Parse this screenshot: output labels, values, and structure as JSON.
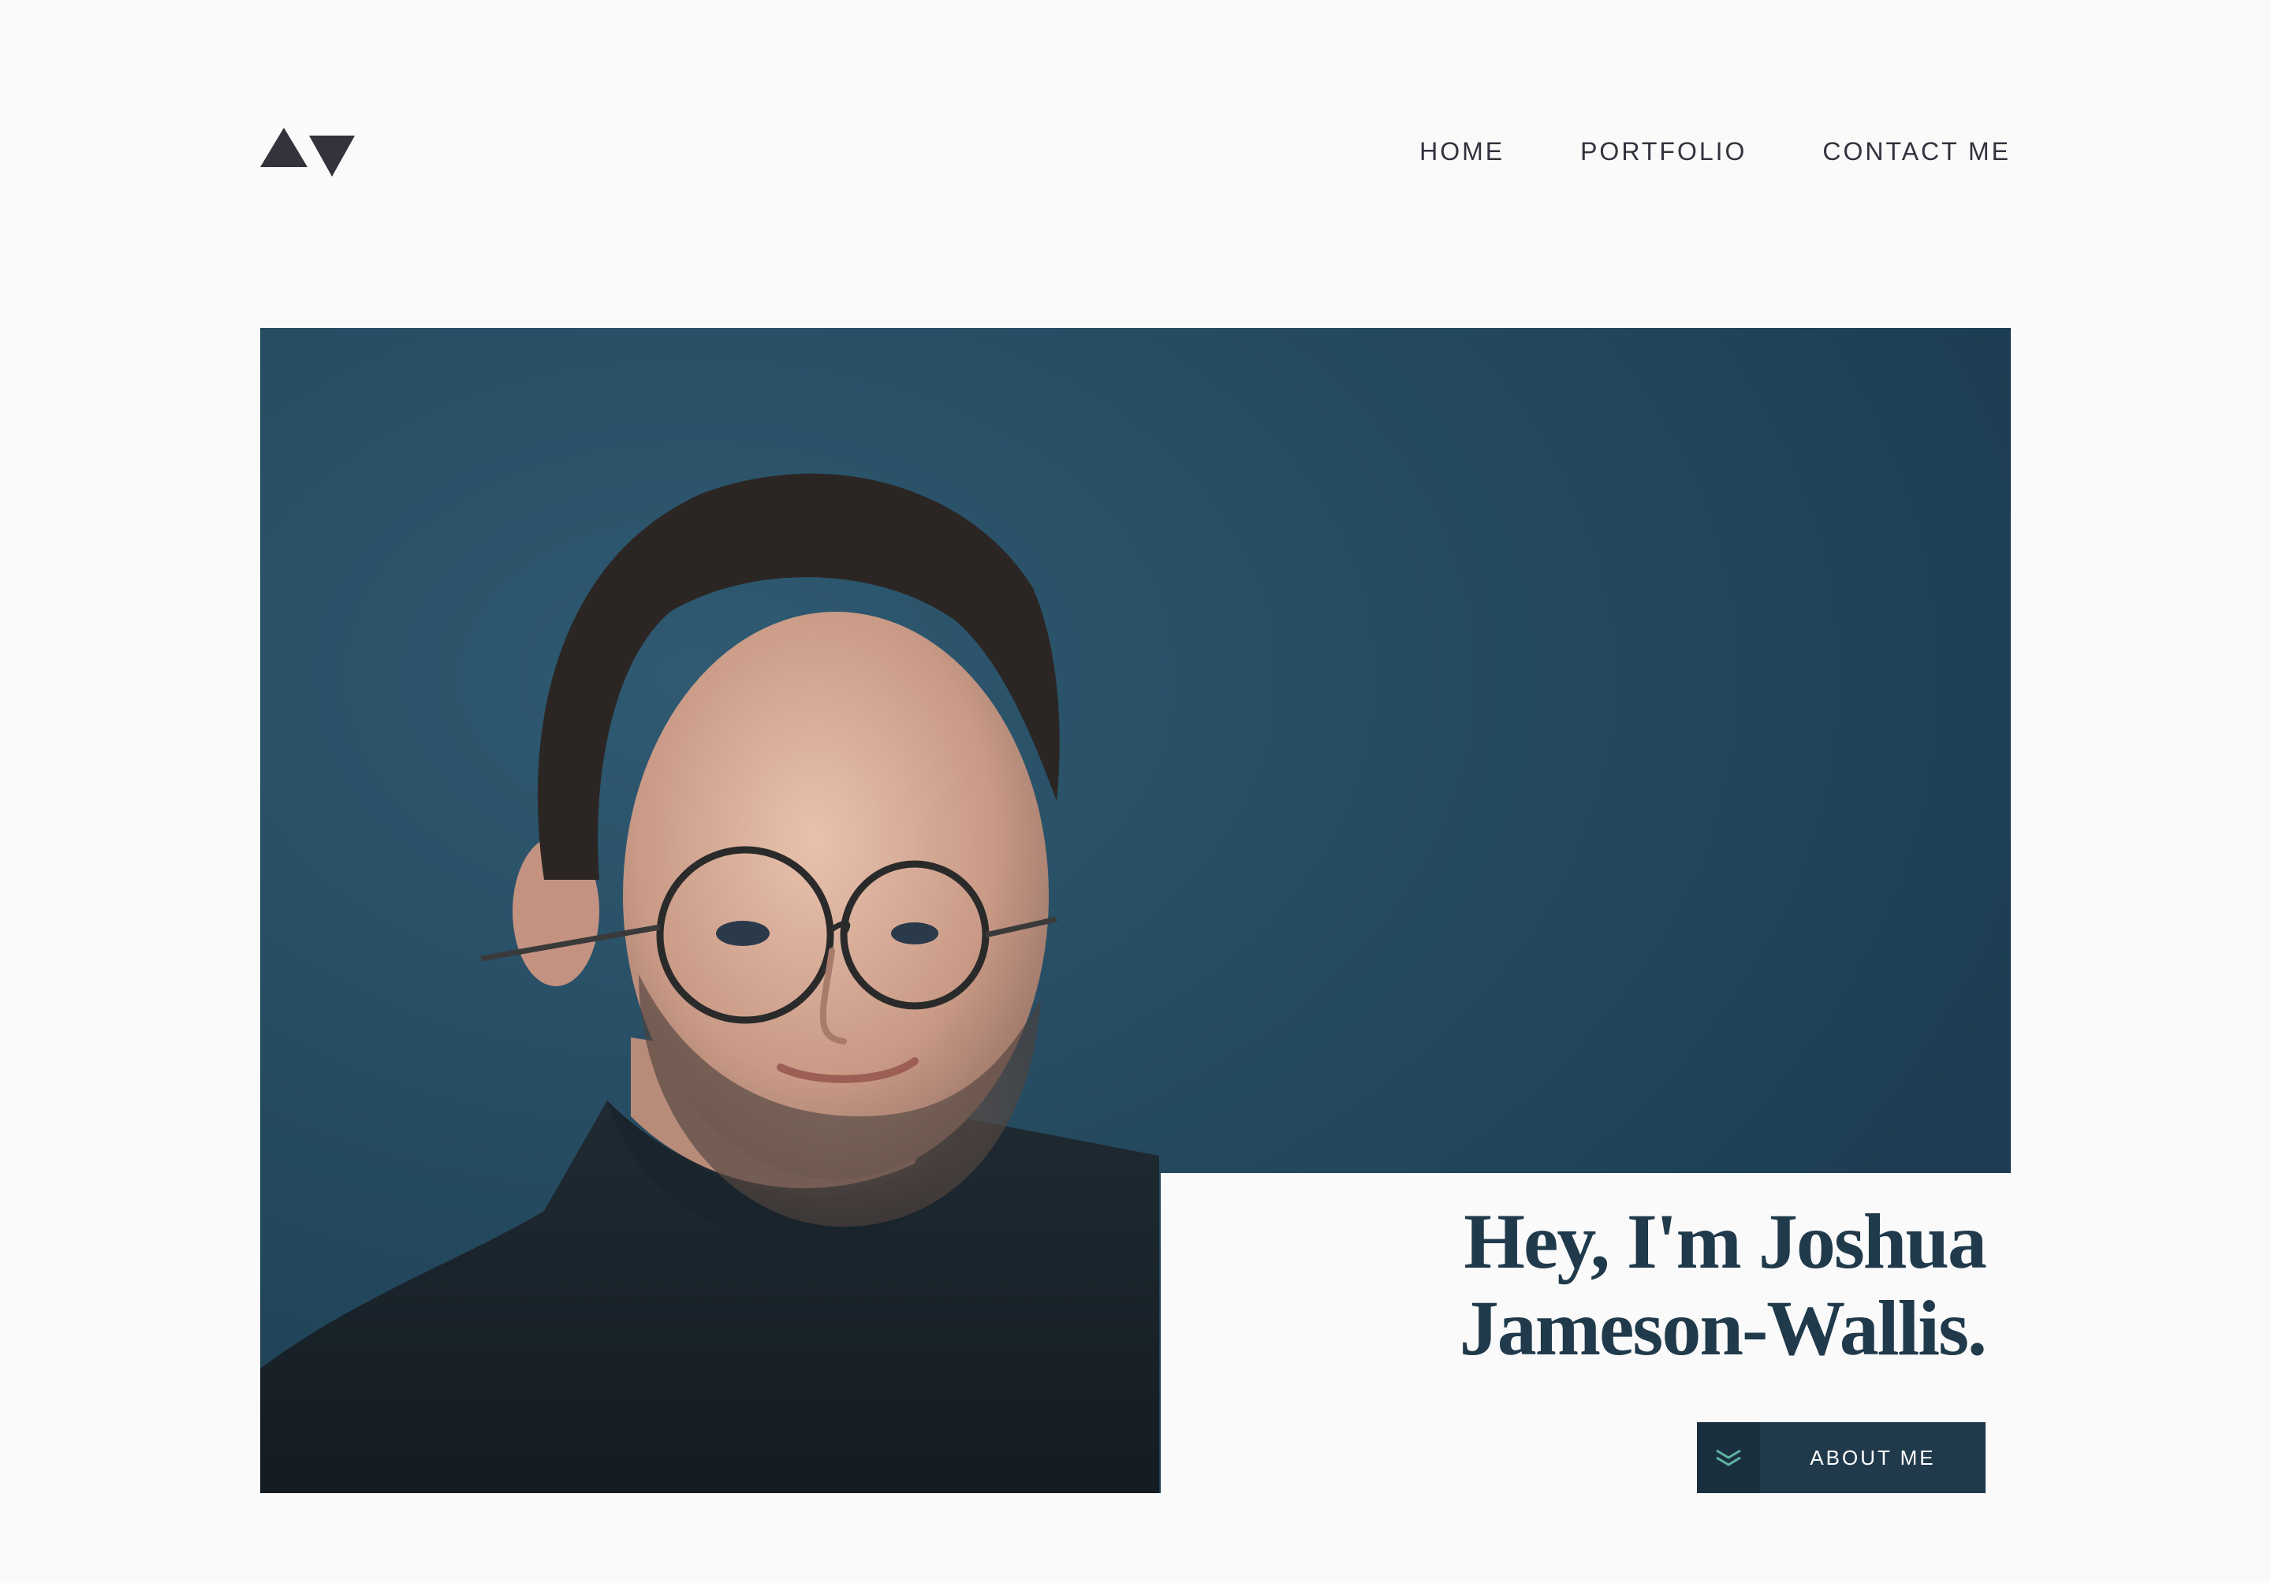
{
  "header": {
    "logo_name": "logo-triangles",
    "nav": [
      {
        "label": "HOME"
      },
      {
        "label": "PORTFOLIO"
      },
      {
        "label": "CONTACT ME"
      }
    ]
  },
  "hero": {
    "title_line1": "Hey, I'm Joshua",
    "title_line2": "Jameson-Wallis.",
    "button_label": "ABOUT ME",
    "button_icon": "double-chevron-down-icon"
  },
  "colors": {
    "background": "#fafafa",
    "text_dark": "#33323d",
    "brand_dark_blue": "#203a4c",
    "accent_cyan": "#5fb4a2"
  }
}
